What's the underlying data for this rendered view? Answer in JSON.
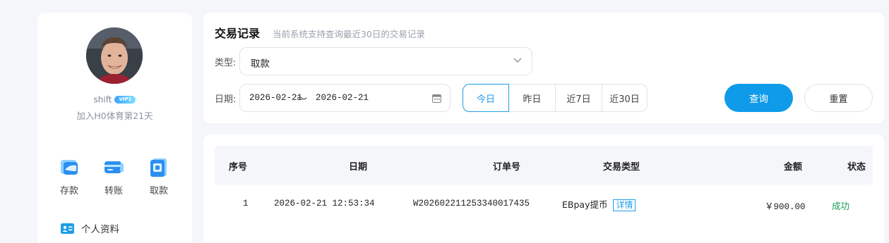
{
  "user": {
    "name": "shift",
    "vip_badge": "VIP1",
    "joined_text": "加入H0体育第21天"
  },
  "quick_actions": [
    {
      "label": "存款",
      "icon": "deposit-card-icon"
    },
    {
      "label": "转账",
      "icon": "transfer-card-icon"
    },
    {
      "label": "取款",
      "icon": "withdraw-icon"
    }
  ],
  "menu": {
    "profile": {
      "label": "个人资料",
      "icon": "id-card-icon"
    }
  },
  "search": {
    "title": "交易记录",
    "subtitle": "当前系统支持查询最近30日的交易记录",
    "type_label": "类型:",
    "type_value": "取款",
    "date_label": "日期:",
    "date_start": "2026-02-21",
    "date_sep": "〜",
    "date_end": "2026-02-21",
    "ranges": [
      "今日",
      "昨日",
      "近7日",
      "近30日"
    ],
    "active_range": "今日",
    "query_label": "查询",
    "reset_label": "重置"
  },
  "table": {
    "headers": {
      "seq": "序号",
      "date": "日期",
      "order": "订单号",
      "type": "交易类型",
      "amount": "金额",
      "status": "状态"
    },
    "rows": [
      {
        "seq": "1",
        "date": "2026-02-21 12:53:34",
        "order": "W20260221125334001743 5",
        "type": "EBpay提币",
        "detail": "详情",
        "amount": "￥900.00",
        "status": "成功"
      }
    ]
  },
  "colors": {
    "accent": "#0f9be9",
    "success": "#18a058",
    "background": "#f4f6fa"
  }
}
